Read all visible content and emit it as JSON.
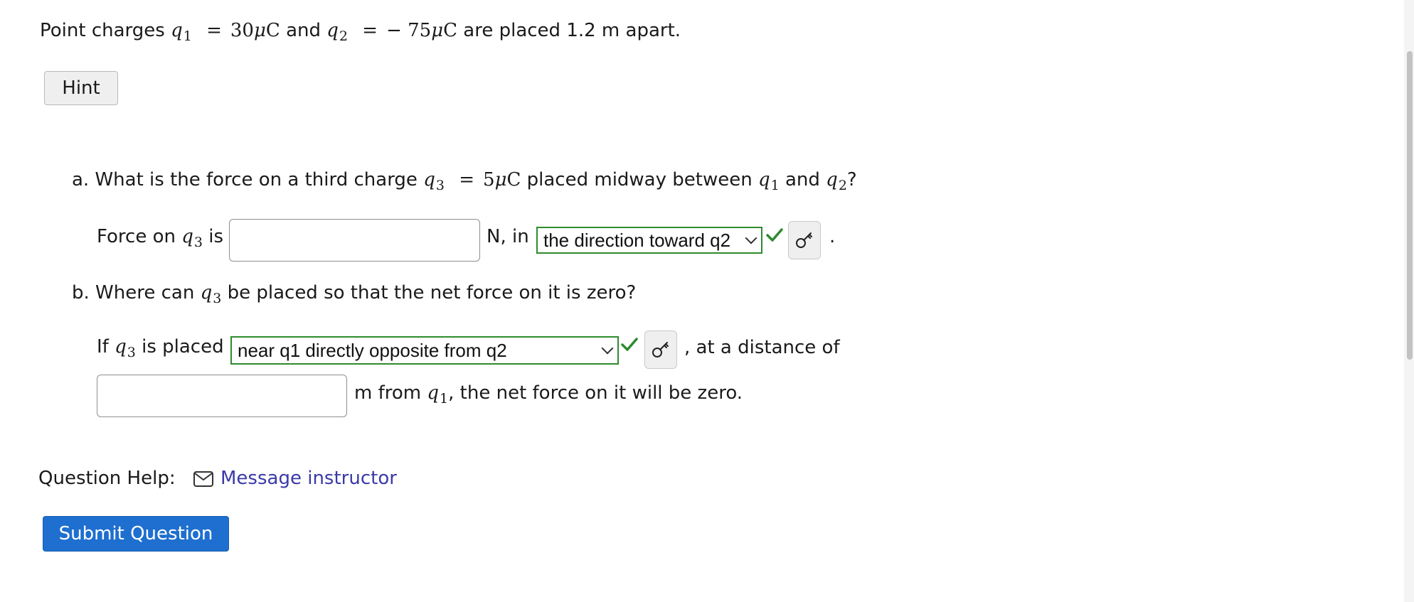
{
  "intro": {
    "prefix": "Point charges",
    "q1_var": "q",
    "q1_sub": "1",
    "q1_eq": "=",
    "q1_val": "30",
    "mu": "μ",
    "unit_C": "C",
    "and": "and",
    "q2_var": "q",
    "q2_sub": "2",
    "q2_eq": "=",
    "q2_val": "− 75",
    "suffix": "are placed 1.2 m apart."
  },
  "hint_button": "Hint",
  "part_a": {
    "question_prefix": "a. What is the force on a third charge",
    "q3_var": "q",
    "q3_sub": "3",
    "q3_eq": "=",
    "q3_val": "5",
    "question_mid": "placed midway between",
    "q1_var": "q",
    "q1_sub": "1",
    "and": "and",
    "q2_var": "q",
    "q2_sub": "2",
    "question_end": "?",
    "answer_prefix": "Force on",
    "answer_q3_var": "q",
    "answer_q3_sub": "3",
    "answer_is": "is",
    "force_input_value": "",
    "unit_text": "N, in",
    "direction_select_value": "the direction toward q2",
    "end_punct": "."
  },
  "part_b": {
    "question_prefix": "b. Where can",
    "q3_var": "q",
    "q3_sub": "3",
    "question_suffix": "be placed so that the net force on it is zero?",
    "answer_prefix": "If",
    "answer_q3_var": "q",
    "answer_q3_sub": "3",
    "answer_mid": "is placed",
    "location_select_value": "near q1 directly opposite from q2",
    "distance_text": ", at a distance of",
    "distance_input_value": "",
    "after_prefix": "m from",
    "after_q1_var": "q",
    "after_q1_sub": "1",
    "after_suffix": ", the net force on it will be zero."
  },
  "question_help": {
    "label": "Question Help:",
    "icon": "envelope-icon",
    "link_text": "Message instructor"
  },
  "submit_button": "Submit Question",
  "colors": {
    "correct_green": "#2e8b2e",
    "link": "#3a3aa8",
    "submit_bg": "#1e6fcf"
  }
}
